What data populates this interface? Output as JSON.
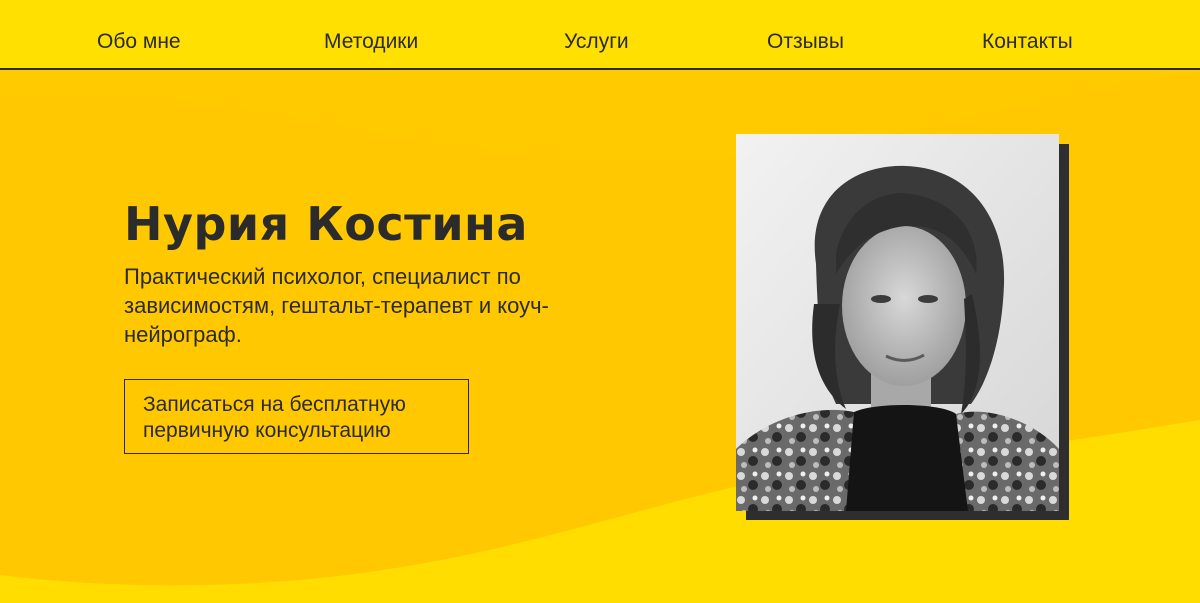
{
  "nav": {
    "items": [
      {
        "label": "Обо мне"
      },
      {
        "label": "Методики"
      },
      {
        "label": "Услуги"
      },
      {
        "label": "Отзывы"
      },
      {
        "label": "Контакты"
      }
    ]
  },
  "hero": {
    "title": "Нурия Костина",
    "subtitle": "Практический психолог, специалист по зависимостям, гештальт-терапевт и коуч-нейрограф.",
    "cta_label": "Записаться на бесплатную первичную консультацию"
  },
  "colors": {
    "background": "#FFE000",
    "wave": "#FFC800",
    "text": "#2b2b2b",
    "photo_shadow": "#2e2e2e"
  }
}
